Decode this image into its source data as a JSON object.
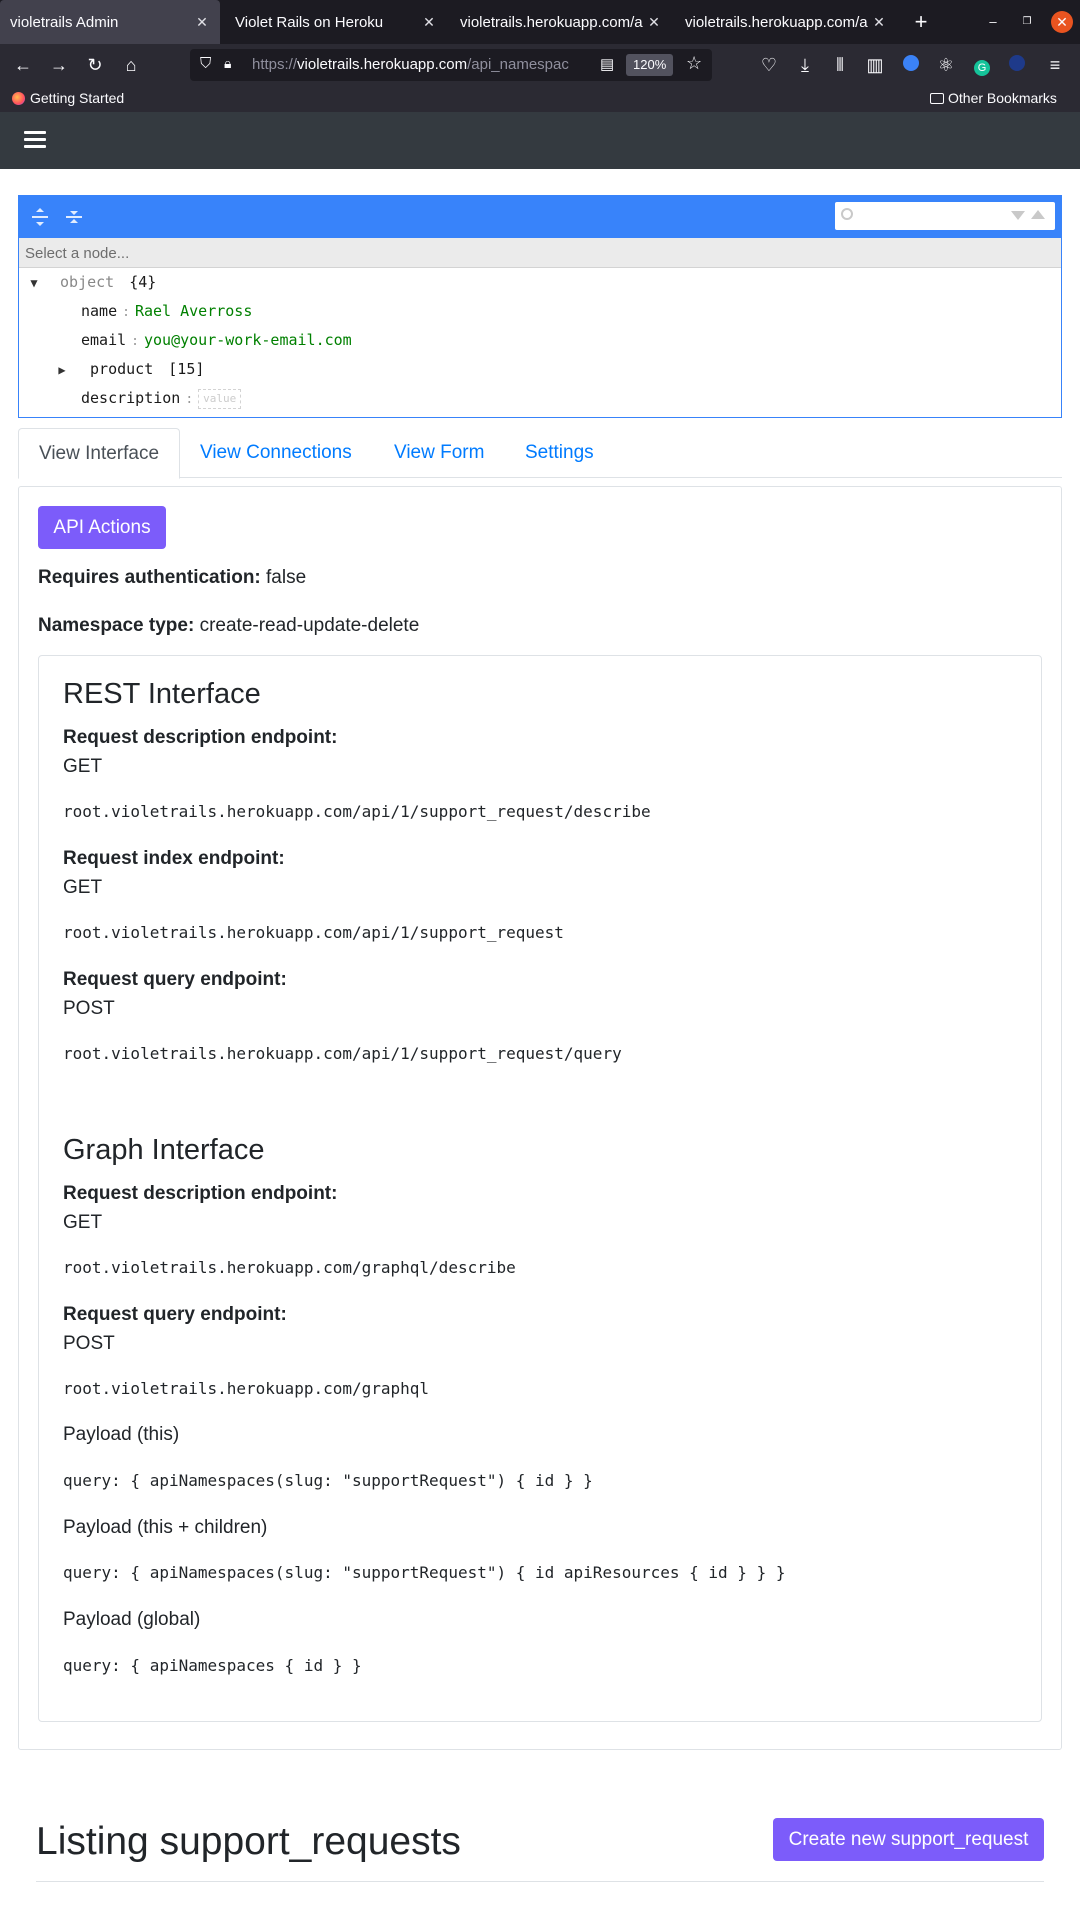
{
  "browser": {
    "tabs": [
      {
        "title": "violetrails Admin",
        "active": true
      },
      {
        "title": "Violet Rails on Heroku",
        "active": false
      },
      {
        "title": "violetrails.herokuapp.com/a",
        "active": false
      },
      {
        "title": "violetrails.herokuapp.com/a",
        "active": false
      }
    ],
    "url_prefix": "https://",
    "url_host": "violetrails.herokuapp.com",
    "url_path": "/api_namespac",
    "zoom": "120%",
    "bookmarks": {
      "getting_started": "Getting Started",
      "other": "Other Bookmarks"
    }
  },
  "json_editor": {
    "nav_placeholder": "Select a node...",
    "root_label": "object",
    "root_count": "{4}",
    "fields": [
      {
        "key": "name",
        "value": "Rael Averross"
      },
      {
        "key": "email",
        "value": "you@your-work-email.com"
      },
      {
        "key": "product",
        "count": "[15]"
      },
      {
        "key": "description",
        "empty_label": "value"
      }
    ]
  },
  "tabs": [
    {
      "label": "View Interface",
      "active": true
    },
    {
      "label": "View Connections",
      "active": false
    },
    {
      "label": "View Form",
      "active": false
    },
    {
      "label": "Settings",
      "active": false
    }
  ],
  "interface": {
    "api_actions_label": "API Actions",
    "auth_label": "Requires authentication:",
    "auth_value": "false",
    "ns_type_label": "Namespace type:",
    "ns_type_value": "create-read-update-delete",
    "rest": {
      "title": "REST Interface",
      "endpoints": [
        {
          "label": "Request description endpoint:",
          "verb": "GET",
          "url": "root.violetrails.herokuapp.com/api/1/support_request/describe"
        },
        {
          "label": "Request index endpoint:",
          "verb": "GET",
          "url": "root.violetrails.herokuapp.com/api/1/support_request"
        },
        {
          "label": "Request query endpoint:",
          "verb": "POST",
          "url": "root.violetrails.herokuapp.com/api/1/support_request/query"
        }
      ]
    },
    "graph": {
      "title": "Graph Interface",
      "endpoints": [
        {
          "label": "Request description endpoint:",
          "verb": "GET",
          "url": "root.violetrails.herokuapp.com/graphql/describe"
        },
        {
          "label": "Request query endpoint:",
          "verb": "POST",
          "url": "root.violetrails.herokuapp.com/graphql"
        }
      ],
      "payloads": [
        {
          "label": "Payload (this)",
          "query": "query: { apiNamespaces(slug: \"supportRequest\") { id } }"
        },
        {
          "label": "Payload (this + children)",
          "query": "query: { apiNamespaces(slug: \"supportRequest\") { id apiResources { id } } }"
        },
        {
          "label": "Payload (global)",
          "query": "query: { apiNamespaces { id } }"
        }
      ]
    }
  },
  "listing": {
    "title": "Listing support_requests",
    "create_label": "Create new support_request"
  },
  "colors": {
    "accent": "#7c5cfa",
    "editor_blue": "#3883fa",
    "link": "#007bff",
    "navbar": "#343a40"
  }
}
